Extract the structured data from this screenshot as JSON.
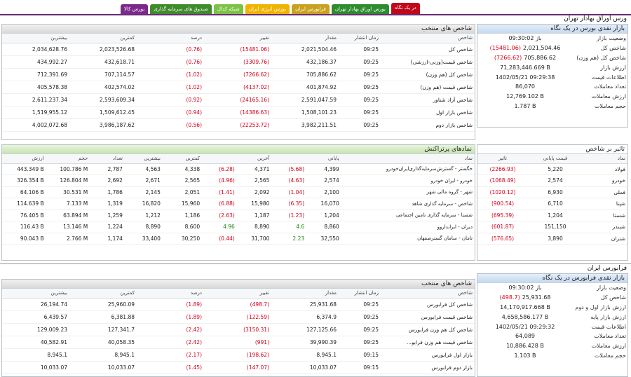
{
  "tabs": [
    {
      "label": "در یک نگاه",
      "color": "#c0071b",
      "active": true
    },
    {
      "label": "بورس اوراق بهادار تهران",
      "color": "#2e8b2e",
      "active": false
    },
    {
      "label": "فرابورس ایران",
      "color": "#c8a21f",
      "active": false
    },
    {
      "label": "بورس انرژی ایران",
      "color": "#f0b400",
      "active": false
    },
    {
      "label": "شبکه کدال",
      "color": "#7cc246",
      "active": false
    },
    {
      "label": "صندوق های سرمایه گذاری",
      "color": "#3f8b2c",
      "active": false
    },
    {
      "label": "بورس کالا",
      "color": "#7b2a8c",
      "active": false
    }
  ],
  "colors": {
    "rule": "#6a2b77",
    "negative": "#d4001a",
    "positive": "#1f8a12"
  },
  "tse": {
    "section_title": "ورس اوراق بهادار تهران",
    "glance": {
      "title": "بازار نقدی بورس در یک نگاه",
      "rows": [
        {
          "label": "وضعیت بازار",
          "value": "باز 09:30:02",
          "change": ""
        },
        {
          "label": "شاخص کل",
          "value": "2,021,504.46",
          "change": "(15481.06)"
        },
        {
          "label": "شاخص کل (هم وزن)",
          "value": "705,886.62",
          "change": "(7266.62)"
        },
        {
          "label": "ارزش بازار",
          "value": "71,283,446.669 B",
          "change": ""
        },
        {
          "label": "اطلاعات قیمت",
          "value": "1402/05/21 09:29:38",
          "change": ""
        },
        {
          "label": "تعداد معاملات",
          "value": "86,070",
          "change": ""
        },
        {
          "label": "ارزش معاملات",
          "value": "12,769.102 B",
          "change": ""
        },
        {
          "label": "حجم معاملات",
          "value": "1.787 B",
          "change": ""
        }
      ]
    },
    "indices": {
      "title": "شاخص های منتخب",
      "headers": {
        "name": "شاخص",
        "time": "زمان انتشار",
        "value": "مقدار",
        "change": "تغییر",
        "percent": "درصد",
        "low": "کمترین",
        "high": "بیشترین"
      },
      "rows": [
        {
          "name": "شاخص کل",
          "time": "09:25",
          "value": "2,021,504.46",
          "change": "(15481.06)",
          "percent": "(0.76)",
          "low": "2,023,526.68",
          "high": "2,034,628.76"
        },
        {
          "name": "شاخص قیمت(وزنی-ارزشی)",
          "time": "09:25",
          "value": "432,186.37",
          "change": "(3309.76)",
          "percent": "(0.76)",
          "low": "432,618.71",
          "high": "434,992.27"
        },
        {
          "name": "شاخص کل (هم وزن)",
          "time": "09:25",
          "value": "705,886.62",
          "change": "(7266.62)",
          "percent": "(1.02)",
          "low": "707,114.57",
          "high": "712,391.69"
        },
        {
          "name": "شاخص قیمت (هم وزن)",
          "time": "09:25",
          "value": "401,874.92",
          "change": "(4137.02)",
          "percent": "(1.02)",
          "low": "402,574.02",
          "high": "405,578.38"
        },
        {
          "name": "شاخص آزاد شناور",
          "time": "09:25",
          "value": "2,591,047.59",
          "change": "(24165.16)",
          "percent": "(0.92)",
          "low": "2,593,609.34",
          "high": "2,611,237.34"
        },
        {
          "name": "شاخص بازار اول",
          "time": "09:25",
          "value": "1,508,101.23",
          "change": "(14386.63)",
          "percent": "(0.94)",
          "low": "1,509,612.45",
          "high": "1,519,955.12"
        },
        {
          "name": "شاخص بازار دوم",
          "time": "09:25",
          "value": "3,982,211.51",
          "change": "(22253.72)",
          "percent": "(0.56)",
          "low": "3,986,187.62",
          "high": "4,002,072.68"
        }
      ]
    },
    "impact": {
      "title": "تاثیر بر شاخص",
      "headers": {
        "symbol": "نماد",
        "close": "قیمت پایانی",
        "effect": "تاثیر"
      },
      "rows": [
        {
          "symbol": "فولاد",
          "close": "5,220",
          "effect": "(2266.93)"
        },
        {
          "symbol": "خودرو",
          "close": "2,574",
          "effect": "(1068.49)"
        },
        {
          "symbol": "فملی",
          "close": "6,930",
          "effect": "(1020.12)"
        },
        {
          "symbol": "شپنا",
          "close": "6,710",
          "effect": "(900.54)"
        },
        {
          "symbol": "شستا",
          "close": "1,204",
          "effect": "(695.39)"
        },
        {
          "symbol": "شبندر",
          "close": "151,150",
          "effect": "(601.87)"
        },
        {
          "symbol": "شتران",
          "close": "3,890",
          "effect": "(576.65)"
        }
      ]
    },
    "popular": {
      "title": "نمادهای پرتراکنش",
      "headers": {
        "symbol": "نماد",
        "close": "پایانی",
        "last": "آخرین",
        "low": "کمترین",
        "high": "بیشترین",
        "count": "تعداد",
        "volume": "حجم",
        "value": "ارزش"
      },
      "rows": [
        {
          "symbol": "خگستر - گسترش‌سرمایه‌گذاری‌ایران‌خودرو",
          "close": "4,399",
          "close_chg": "(5.68)",
          "close_pos": false,
          "last": "4,371",
          "last_chg": "(6.28)",
          "last_pos": false,
          "low": "4,338",
          "high": "4,563",
          "count": "2,787",
          "volume": "100.786 M",
          "value": "443.349 B"
        },
        {
          "symbol": "خودرو - ایران‌ خودرو",
          "close": "2,574",
          "close_chg": "(4.63)",
          "close_pos": false,
          "last": "2,565",
          "last_chg": "(4.96)",
          "last_pos": false,
          "low": "2,565",
          "high": "2,671",
          "count": "2,692",
          "volume": "126.804 M",
          "value": "326.354 B"
        },
        {
          "symbol": "شهر - گروه مالی شهر",
          "close": "2,100",
          "close_chg": "(1.04)",
          "close_pos": false,
          "last": "2,092",
          "last_chg": "(1.41)",
          "last_pos": false,
          "low": "2,051",
          "high": "2,145",
          "count": "1,786",
          "volume": "30.531 M",
          "value": "64.106 B"
        },
        {
          "symbol": "شاخص - سرمایه گذاری شاهد",
          "close": "16,070",
          "close_chg": "(6.35)",
          "close_pos": false,
          "last": "15,980",
          "last_chg": "(6.88)",
          "last_pos": false,
          "low": "15,960",
          "high": "16,820",
          "count": "1,319",
          "volume": "7.133 M",
          "value": "114.639 B"
        },
        {
          "symbol": "شستا - سرمایه گذاری تامین اجتماعی",
          "close": "1,204",
          "close_chg": "(1.23)",
          "close_pos": false,
          "last": "1,187",
          "last_chg": "(2.63)",
          "last_pos": false,
          "low": "1,186",
          "high": "1,212",
          "count": "1,259",
          "volume": "63.894 M",
          "value": "76.405 B"
        },
        {
          "symbol": "دیران - ایرانداروو",
          "close": "8,860",
          "close_chg": "4.6",
          "close_pos": true,
          "last": "8,890",
          "last_chg": "4.96",
          "last_pos": true,
          "low": "8,600",
          "high": "8,890",
          "count": "1,224",
          "volume": "13.146 M",
          "value": "116.43 B"
        },
        {
          "symbol": "تامان - سامان گسترصفهان",
          "close": "32,550",
          "close_chg": "2.23",
          "close_pos": true,
          "last": "31,700",
          "last_chg": "(0.44)",
          "last_pos": false,
          "low": "30,250",
          "high": "33,400",
          "count": "1,174",
          "volume": "2.766 M",
          "value": "90.043 B"
        }
      ]
    }
  },
  "ifb": {
    "section_title": "فرابورس ایران",
    "glance": {
      "title": "بازار نقدی فرابورس در یک نگاه",
      "rows": [
        {
          "label": "وضعیت بازار",
          "value": "باز 09:30:02",
          "change": ""
        },
        {
          "label": "شاخص کل",
          "value": "25,931.68",
          "change": "(498.7)"
        },
        {
          "label": "ارزش بازار اول و دوم",
          "value": "14,170,917.668 B",
          "change": ""
        },
        {
          "label": "ارزش بازار پایه",
          "value": "4,658,586.177 B",
          "change": ""
        },
        {
          "label": "اطلاعات قیمت",
          "value": "1402/05/21 09:29:32",
          "change": ""
        },
        {
          "label": "تعداد معاملات",
          "value": "64,089",
          "change": ""
        },
        {
          "label": "ارزش معاملات",
          "value": "10,886.428 B",
          "change": ""
        },
        {
          "label": "حجم معاملات",
          "value": "1.103 B",
          "change": ""
        }
      ]
    },
    "indices": {
      "title": "شاخص های منتخب",
      "headers": {
        "name": "شاخص",
        "time": "زمان انتشار",
        "value": "مقدار",
        "change": "تغییر",
        "percent": "درصد",
        "low": "کمترین",
        "high": "بیشترین"
      },
      "rows": [
        {
          "name": "شاخص کل فرابورس",
          "time": "09:25",
          "value": "25,931.68",
          "change": "(498.7)",
          "percent": "(1.89)",
          "low": "25,960.09",
          "high": "26,194.74"
        },
        {
          "name": "شاخص قیمت فرابورس",
          "time": "09:25",
          "value": "6,374.9",
          "change": "(122.59)",
          "percent": "(1.89)",
          "low": "6,381.88",
          "high": "6,439.57"
        },
        {
          "name": "شاخص کل هم وزن فرابورس",
          "time": "09:25",
          "value": "127,125.66",
          "change": "(3150.31)",
          "percent": "(2.42)",
          "low": "127,341.7",
          "high": "129,009.23"
        },
        {
          "name": "شاخص قیمت هم وزن فرابو...",
          "time": "09:25",
          "value": "39,990.39",
          "change": "(991)",
          "percent": "(2.42)",
          "low": "40,058.35",
          "high": "40,582.91"
        },
        {
          "name": "بازار اول فرابورس",
          "time": "09:15",
          "value": "8,945.1",
          "change": "(198.62)",
          "percent": "(2.17)",
          "low": "8,945.1",
          "high": "8,945.1"
        },
        {
          "name": "بازار دوم فرابورس",
          "time": "09:15",
          "value": "10,033.07",
          "change": "(147.07)",
          "percent": "(1.45)",
          "low": "10,033.07",
          "high": "10,033.07"
        }
      ]
    }
  }
}
